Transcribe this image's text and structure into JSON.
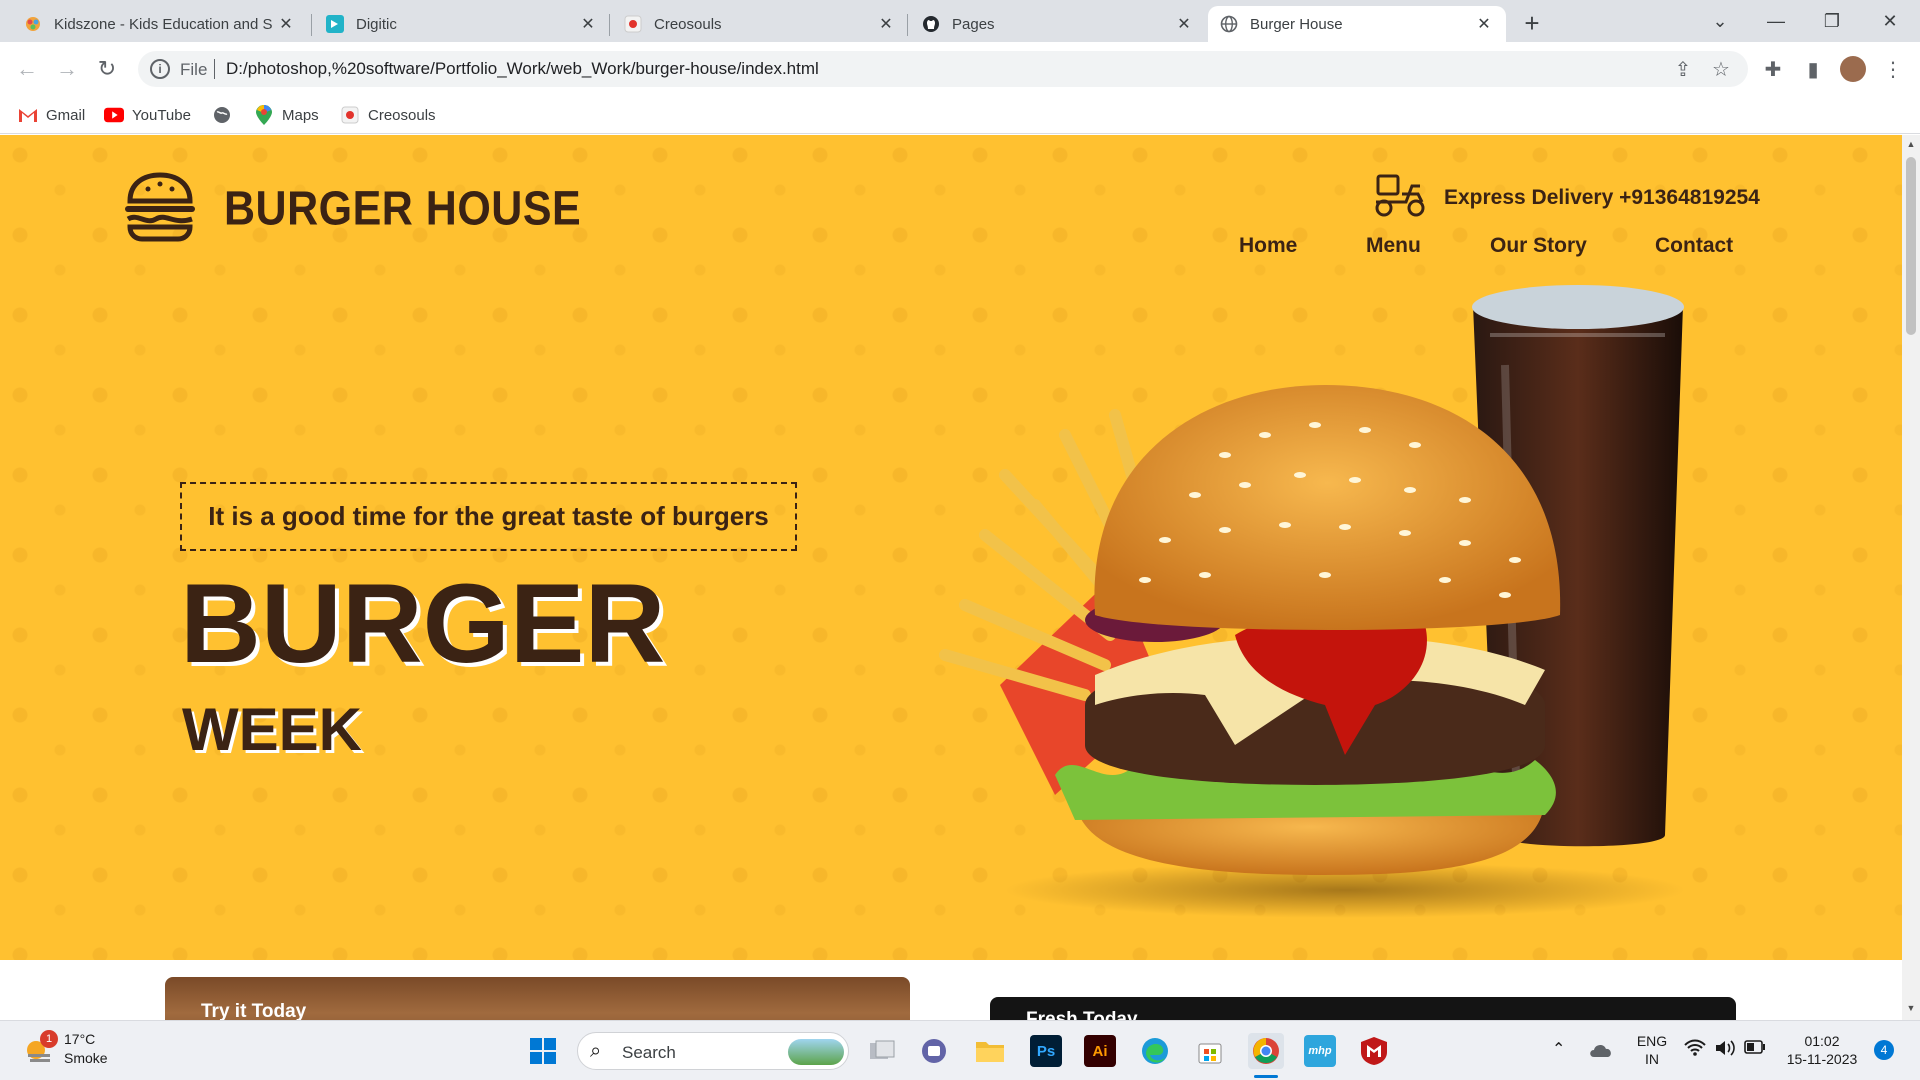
{
  "browser": {
    "tabs": [
      {
        "title": "Kidszone - Kids Education and S",
        "icon": "kidszone-icon",
        "active": false
      },
      {
        "title": "Digitic",
        "icon": "digitic-icon",
        "active": false
      },
      {
        "title": "Creosouls",
        "icon": "creosouls-icon",
        "active": false
      },
      {
        "title": "Pages",
        "icon": "github-icon",
        "active": false
      },
      {
        "title": "Burger House",
        "icon": "globe-icon",
        "active": true
      }
    ],
    "address": {
      "scheme": "File",
      "url": "D:/photoshop,%20software/Portfolio_Work/web_Work/burger-house/index.html"
    },
    "bookmarks": [
      "Gmail",
      "YouTube",
      "Maps",
      "Creosouls"
    ]
  },
  "page": {
    "brand": "BURGER HOUSE",
    "delivery": "Express Delivery +91364819254",
    "menu": [
      "Home",
      "Menu",
      "Our Story",
      "Contact"
    ],
    "tagline": "It is a good time for the great taste of burgers",
    "headline": "BURGER",
    "subheadline": "WEEK",
    "cards": [
      "Try it Today",
      "Fresh Today"
    ]
  },
  "taskbar": {
    "weather": {
      "temp": "17°C",
      "condition": "Smoke",
      "badge": "1"
    },
    "search_label": "Search",
    "apps": [
      "file-explorer-icon",
      "teams-icon",
      "folder-icon",
      "photoshop-icon",
      "illustrator-icon",
      "edge-icon",
      "store-icon",
      "chrome-icon",
      "mhp-icon",
      "mcafee-icon"
    ],
    "lang": {
      "top": "ENG",
      "bottom": "IN"
    },
    "time": "01:02",
    "date": "15-11-2023",
    "notifications": "4"
  },
  "colors": {
    "hero_bg": "#ffc130",
    "brand_dark": "#3b2314",
    "chrome_frame": "#dee1e6"
  }
}
